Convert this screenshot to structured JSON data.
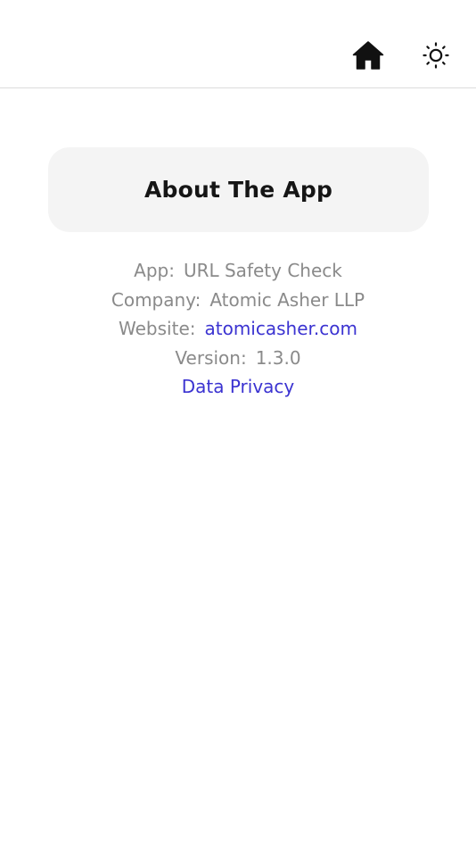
{
  "header": {
    "home_icon": "home-icon",
    "theme_icon": "sun-icon"
  },
  "title_card": {
    "title": "About The App"
  },
  "info": {
    "app_label": "App:",
    "app_value": "URL Safety Check",
    "company_label": "Company:",
    "company_value": "Atomic Asher LLP",
    "website_label": "Website:",
    "website_value": "atomicasher.com",
    "version_label": "Version:",
    "version_value": "1.3.0",
    "privacy_link": "Data Privacy"
  },
  "colors": {
    "link": "#3b33d1",
    "muted_text": "#8a8a8a",
    "card_bg": "#f4f4f4",
    "title_text": "#151515"
  }
}
